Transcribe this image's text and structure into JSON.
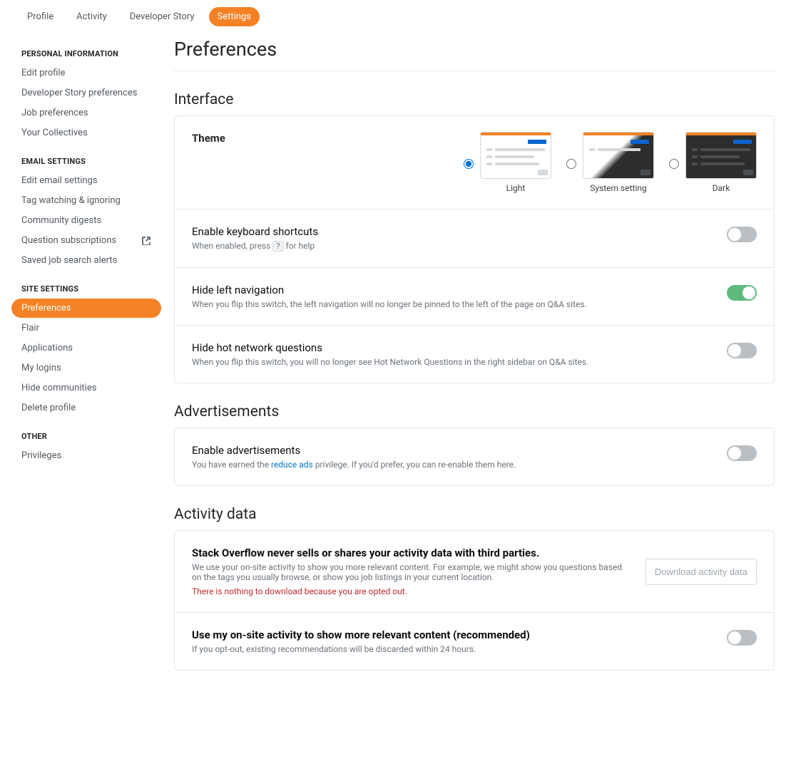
{
  "topnav": {
    "items": [
      {
        "label": "Profile",
        "active": false
      },
      {
        "label": "Activity",
        "active": false
      },
      {
        "label": "Developer Story",
        "active": false
      },
      {
        "label": "Settings",
        "active": true
      }
    ]
  },
  "sidebar": {
    "groups": [
      {
        "title": "PERSONAL INFORMATION",
        "items": [
          {
            "label": "Edit profile"
          },
          {
            "label": "Developer Story preferences"
          },
          {
            "label": "Job preferences"
          },
          {
            "label": "Your Collectives"
          }
        ]
      },
      {
        "title": "EMAIL SETTINGS",
        "items": [
          {
            "label": "Edit email settings"
          },
          {
            "label": "Tag watching & ignoring"
          },
          {
            "label": "Community digests"
          },
          {
            "label": "Question subscriptions",
            "external": true
          },
          {
            "label": "Saved job search alerts"
          }
        ]
      },
      {
        "title": "SITE SETTINGS",
        "items": [
          {
            "label": "Preferences",
            "active": true
          },
          {
            "label": "Flair"
          },
          {
            "label": "Applications"
          },
          {
            "label": "My logins"
          },
          {
            "label": "Hide communities"
          },
          {
            "label": "Delete profile"
          }
        ]
      },
      {
        "title": "OTHER",
        "items": [
          {
            "label": "Privileges"
          }
        ]
      }
    ]
  },
  "page": {
    "title": "Preferences",
    "sections": {
      "interface": {
        "title": "Interface",
        "theme": {
          "label": "Theme",
          "options": [
            {
              "label": "Light",
              "selected": true
            },
            {
              "label": "System setting",
              "selected": false
            },
            {
              "label": "Dark",
              "selected": false
            }
          ]
        },
        "keyboard": {
          "title": "Enable keyboard shortcuts",
          "desc_pre": "When enabled, press ",
          "key": "?",
          "desc_post": " for help",
          "on": false
        },
        "hideleft": {
          "title": "Hide left navigation",
          "desc": "When you flip this switch, the left navigation will no longer be pinned to the left of the page on Q&A sites.",
          "on": true
        },
        "hidehot": {
          "title": "Hide hot network questions",
          "desc": "When you flip this switch, you will no longer see Hot Network Questions in the right sidebar on Q&A sites.",
          "on": false
        }
      },
      "ads": {
        "title": "Advertisements",
        "enable": {
          "title": "Enable advertisements",
          "desc_pre": "You have earned the ",
          "link": "reduce ads",
          "desc_post": " privilege. If you'd prefer, you can re-enable them here.",
          "on": false
        }
      },
      "activity": {
        "title": "Activity data",
        "intro": {
          "title": "Stack Overflow never sells or shares your activity data with third parties.",
          "desc": "We use your on-site activity to show you more relevant content. For example, we might show you questions based on the tags you usually browse, or show you job listings in your current location.",
          "warn": "There is nothing to download because you are opted out.",
          "button": "Download activity data"
        },
        "optin": {
          "title": "Use my on-site activity to show more relevant content (recommended)",
          "desc": "If you opt-out, existing recommendations will be discarded within 24 hours.",
          "on": false
        }
      }
    }
  }
}
